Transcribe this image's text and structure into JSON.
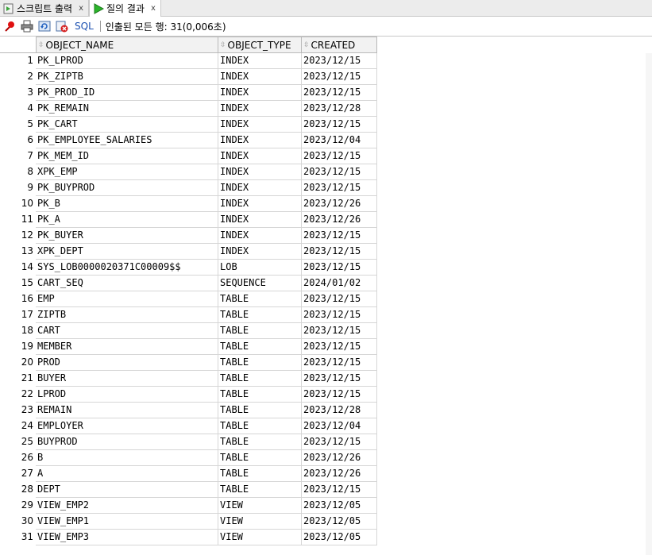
{
  "tabs": [
    {
      "label": "스크립트 출력",
      "close": "x",
      "active": false
    },
    {
      "label": "질의 결과",
      "close": "x",
      "active": true
    }
  ],
  "toolbar": {
    "sql_label": "SQL",
    "status": "인출된 모든 행: 31(0,006초)"
  },
  "grid": {
    "columns": [
      "OBJECT_NAME",
      "OBJECT_TYPE",
      "CREATED"
    ],
    "rows": [
      [
        "1",
        "PK_LPROD",
        "INDEX",
        "2023/12/15"
      ],
      [
        "2",
        "PK_ZIPTB",
        "INDEX",
        "2023/12/15"
      ],
      [
        "3",
        "PK_PROD_ID",
        "INDEX",
        "2023/12/15"
      ],
      [
        "4",
        "PK_REMAIN",
        "INDEX",
        "2023/12/28"
      ],
      [
        "5",
        "PK_CART",
        "INDEX",
        "2023/12/15"
      ],
      [
        "6",
        "PK_EMPLOYEE_SALARIES",
        "INDEX",
        "2023/12/04"
      ],
      [
        "7",
        "PK_MEM_ID",
        "INDEX",
        "2023/12/15"
      ],
      [
        "8",
        "XPK_EMP",
        "INDEX",
        "2023/12/15"
      ],
      [
        "9",
        "PK_BUYPROD",
        "INDEX",
        "2023/12/15"
      ],
      [
        "10",
        "PK_B",
        "INDEX",
        "2023/12/26"
      ],
      [
        "11",
        "PK_A",
        "INDEX",
        "2023/12/26"
      ],
      [
        "12",
        "PK_BUYER",
        "INDEX",
        "2023/12/15"
      ],
      [
        "13",
        "XPK_DEPT",
        "INDEX",
        "2023/12/15"
      ],
      [
        "14",
        "SYS_LOB0000020371C00009$$",
        "LOB",
        "2023/12/15"
      ],
      [
        "15",
        "CART_SEQ",
        "SEQUENCE",
        "2024/01/02"
      ],
      [
        "16",
        "EMP",
        "TABLE",
        "2023/12/15"
      ],
      [
        "17",
        "ZIPTB",
        "TABLE",
        "2023/12/15"
      ],
      [
        "18",
        "CART",
        "TABLE",
        "2023/12/15"
      ],
      [
        "19",
        "MEMBER",
        "TABLE",
        "2023/12/15"
      ],
      [
        "20",
        "PROD",
        "TABLE",
        "2023/12/15"
      ],
      [
        "21",
        "BUYER",
        "TABLE",
        "2023/12/15"
      ],
      [
        "22",
        "LPROD",
        "TABLE",
        "2023/12/15"
      ],
      [
        "23",
        "REMAIN",
        "TABLE",
        "2023/12/28"
      ],
      [
        "24",
        "EMPLOYER",
        "TABLE",
        "2023/12/04"
      ],
      [
        "25",
        "BUYPROD",
        "TABLE",
        "2023/12/15"
      ],
      [
        "26",
        "B",
        "TABLE",
        "2023/12/26"
      ],
      [
        "27",
        "A",
        "TABLE",
        "2023/12/26"
      ],
      [
        "28",
        "DEPT",
        "TABLE",
        "2023/12/15"
      ],
      [
        "29",
        "VIEW_EMP2",
        "VIEW",
        "2023/12/05"
      ],
      [
        "30",
        "VIEW_EMP1",
        "VIEW",
        "2023/12/05"
      ],
      [
        "31",
        "VIEW_EMP3",
        "VIEW",
        "2023/12/05"
      ]
    ]
  },
  "icons": [
    "script-output-icon",
    "run-icon",
    "pin-icon",
    "print-icon",
    "refresh-icon",
    "cancel-icon"
  ]
}
